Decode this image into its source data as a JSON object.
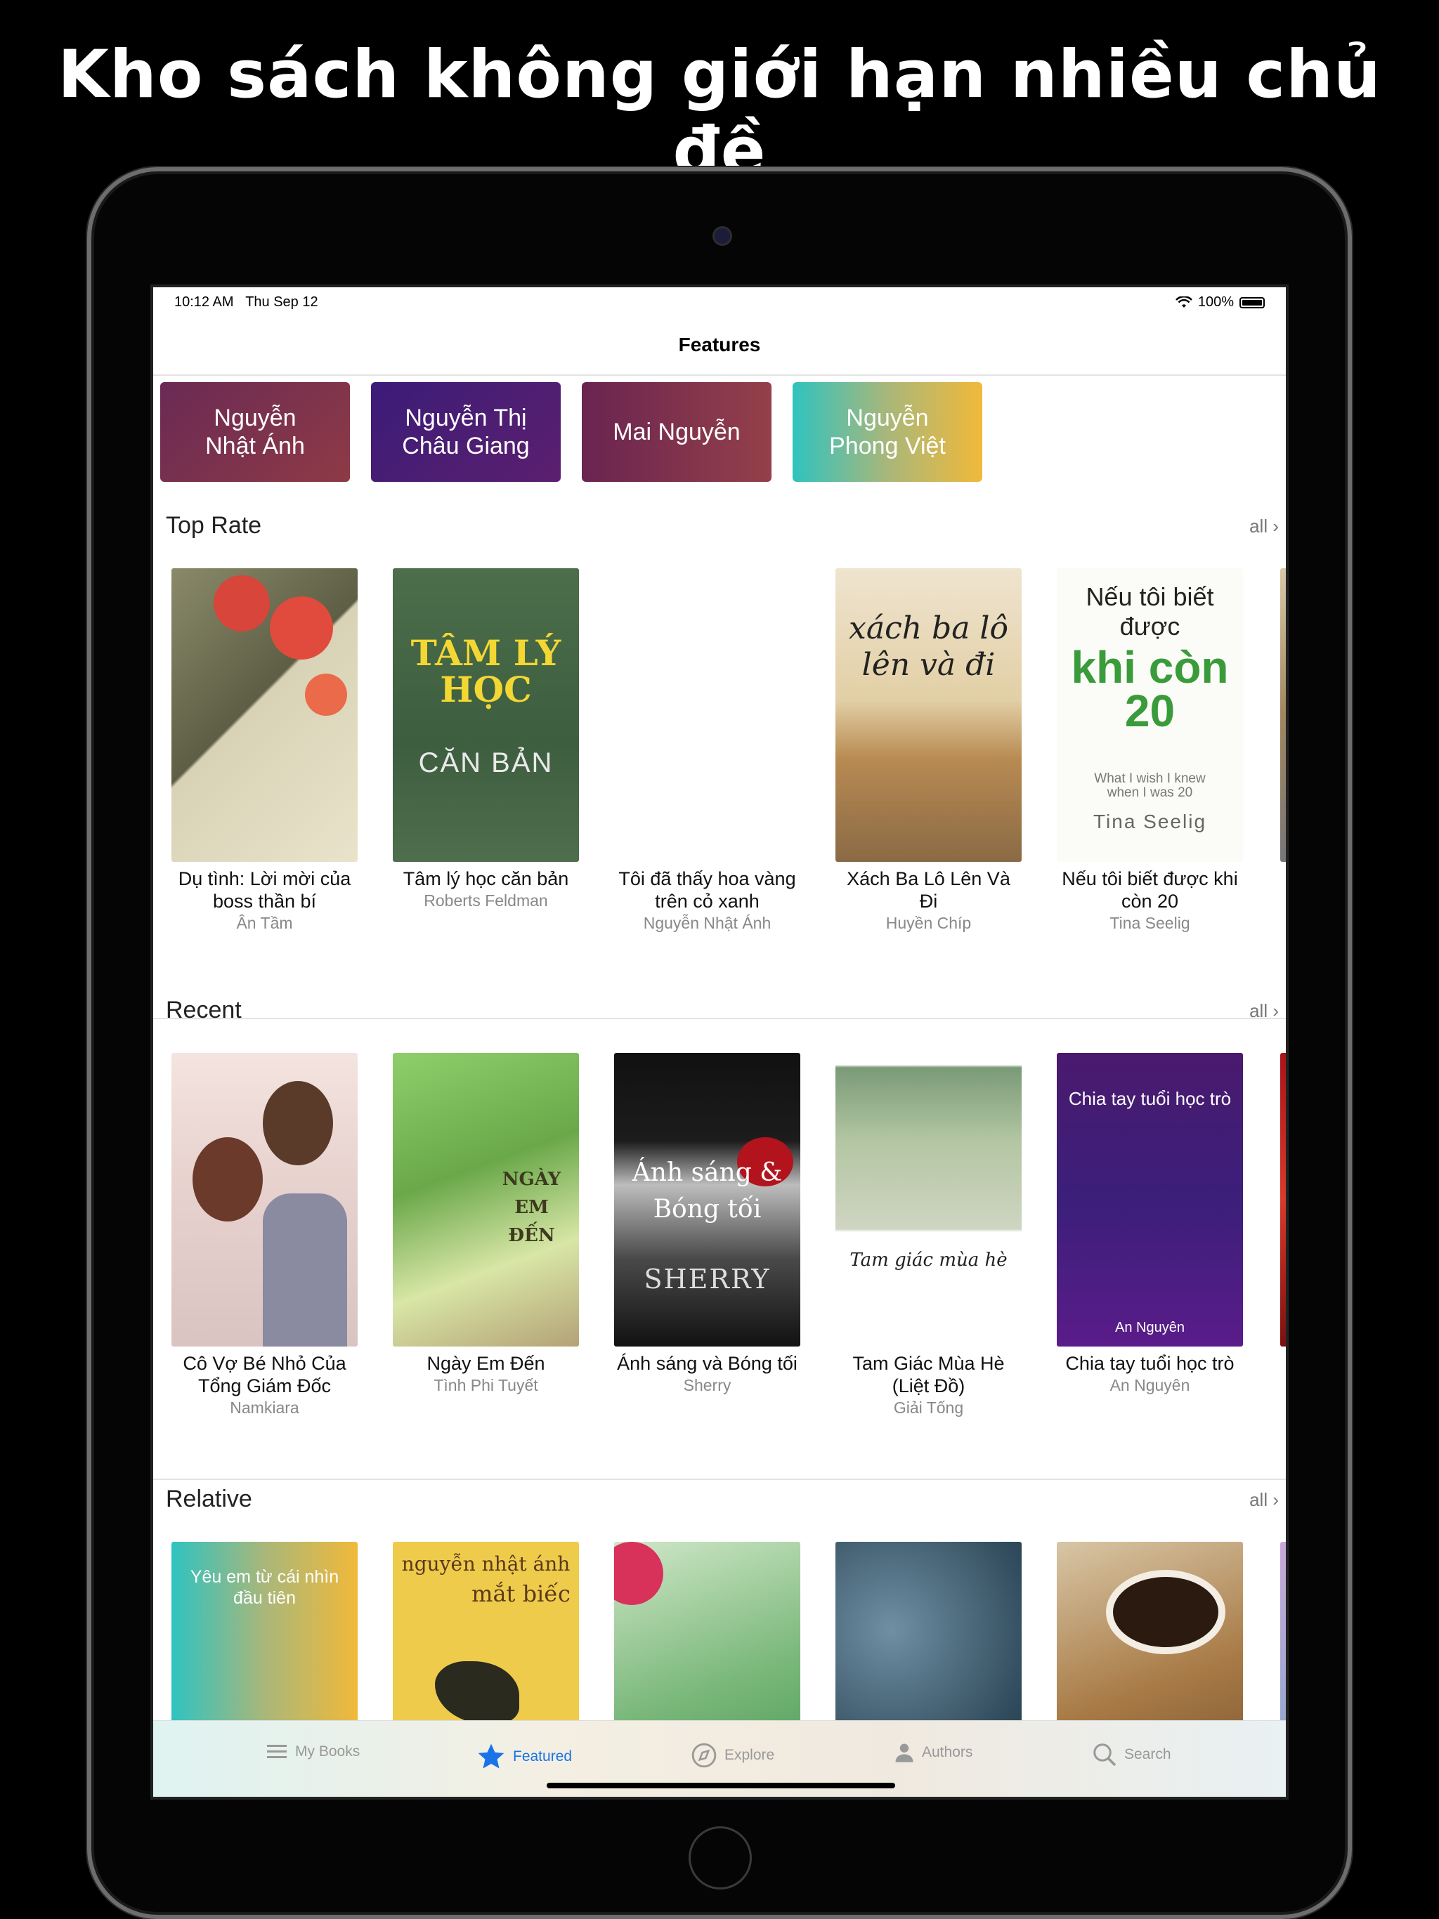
{
  "headline": "Kho sách không giới hạn nhiều chủ đề",
  "status": {
    "time": "10:12 AM",
    "date": "Thu Sep 12",
    "battery": "100%"
  },
  "nav": {
    "title": "Features"
  },
  "authors": [
    {
      "name": "Nguyễn\nNhật Ánh"
    },
    {
      "name": "Nguyễn Thị\nChâu Giang"
    },
    {
      "name": "Mai Nguyễn"
    },
    {
      "name": "Nguyễn\nPhong Việt"
    }
  ],
  "sections": {
    "top_rate": {
      "title": "Top Rate",
      "all": "all",
      "books": [
        {
          "title": "Dụ tình: Lời mời của boss thần bí",
          "author": "Ân Tầm"
        },
        {
          "title": "Tâm lý học căn bản",
          "author": "Roberts Feldman",
          "cover_text": "TÂM LÝ HỌC",
          "cover_sub": "CĂN BẢN"
        },
        {
          "title": "Tôi đã thấy hoa vàng trên cỏ xanh",
          "author": "Nguyễn Nhật Ánh"
        },
        {
          "title": "Xách Ba Lô Lên Và Đi",
          "author": "Huyền Chíp",
          "cover_text": "xách ba lô lên và đi"
        },
        {
          "title": "Nếu tôi biết được khi còn 20",
          "author": "Tina Seelig",
          "cover_text": "Nếu tôi biết được",
          "cover_big": "khi còn 20",
          "cover_sub": "What I wish I knew when I was 20",
          "cover_author": "Tina Seelig"
        }
      ]
    },
    "recent": {
      "title": "Recent",
      "all": "all",
      "books": [
        {
          "title": "Cô Vợ Bé Nhỏ Của Tổng Giám Đốc",
          "author": "Namkiara"
        },
        {
          "title": "Ngày Em Đến",
          "author": "Tình Phi Tuyết",
          "cover_text": "NGÀY EM ĐẾN"
        },
        {
          "title": "Ánh sáng và Bóng tối",
          "author": "Sherry",
          "cover_text": "Ánh sáng & Bóng tối",
          "cover_sub": "SHERRY"
        },
        {
          "title": "Tam Giác Mùa Hè (Liệt Đồ)",
          "author": "Giải Tống",
          "cover_text": "Tam giác mùa hè"
        },
        {
          "title": "Chia tay tuổi học trò",
          "author": "An Nguyên",
          "cover_text": "Chia tay tuổi học trò",
          "cover_sub": "An Nguyên"
        }
      ]
    },
    "relative": {
      "title": "Relative",
      "all": "all",
      "books": [
        {
          "cover_text": "Yêu em từ cái nhìn đầu tiên"
        },
        {
          "cover_text": "nguyễn nhật ánh",
          "cover_sub": "mắt biếc"
        },
        {
          "cover_text": ""
        },
        {
          "cover_text": ""
        },
        {
          "cover_text": ""
        }
      ]
    }
  },
  "tabs": [
    {
      "label": "My Books",
      "icon": "list-icon"
    },
    {
      "label": "Featured",
      "icon": "star-icon",
      "active": true
    },
    {
      "label": "Explore",
      "icon": "compass-icon"
    },
    {
      "label": "Authors",
      "icon": "person-icon"
    },
    {
      "label": "Search",
      "icon": "search-icon"
    }
  ],
  "colors": {
    "accent": "#1a73e8"
  }
}
